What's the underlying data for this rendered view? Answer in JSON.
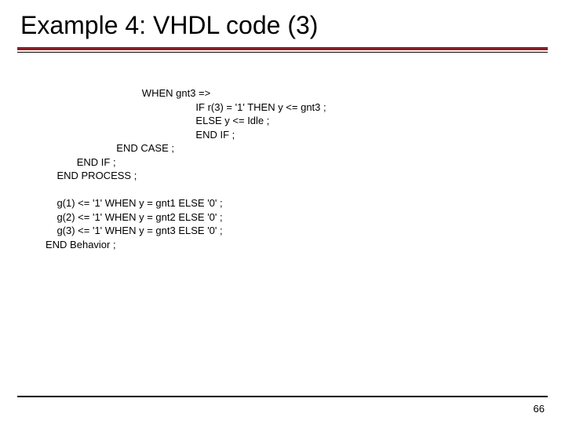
{
  "title": "Example 4: VHDL code (3)",
  "page_number": "66",
  "code_lines": {
    "l0": "                                  WHEN gnt3 =>",
    "l1": "                                                     IF r(3) = '1' THEN y <= gnt3 ;",
    "l2": "                                                     ELSE y <= Idle ;",
    "l3": "                                                     END IF ;",
    "l4": "                         END CASE ;",
    "l5": "           END IF ;",
    "l6": "    END PROCESS ;",
    "l7": "",
    "l8": "    g(1) <= '1' WHEN y = gnt1 ELSE '0' ;",
    "l9": "    g(2) <= '1' WHEN y = gnt2 ELSE '0' ;",
    "l10": "    g(3) <= '1' WHEN y = gnt3 ELSE '0' ;",
    "l11": "END Behavior ;"
  }
}
